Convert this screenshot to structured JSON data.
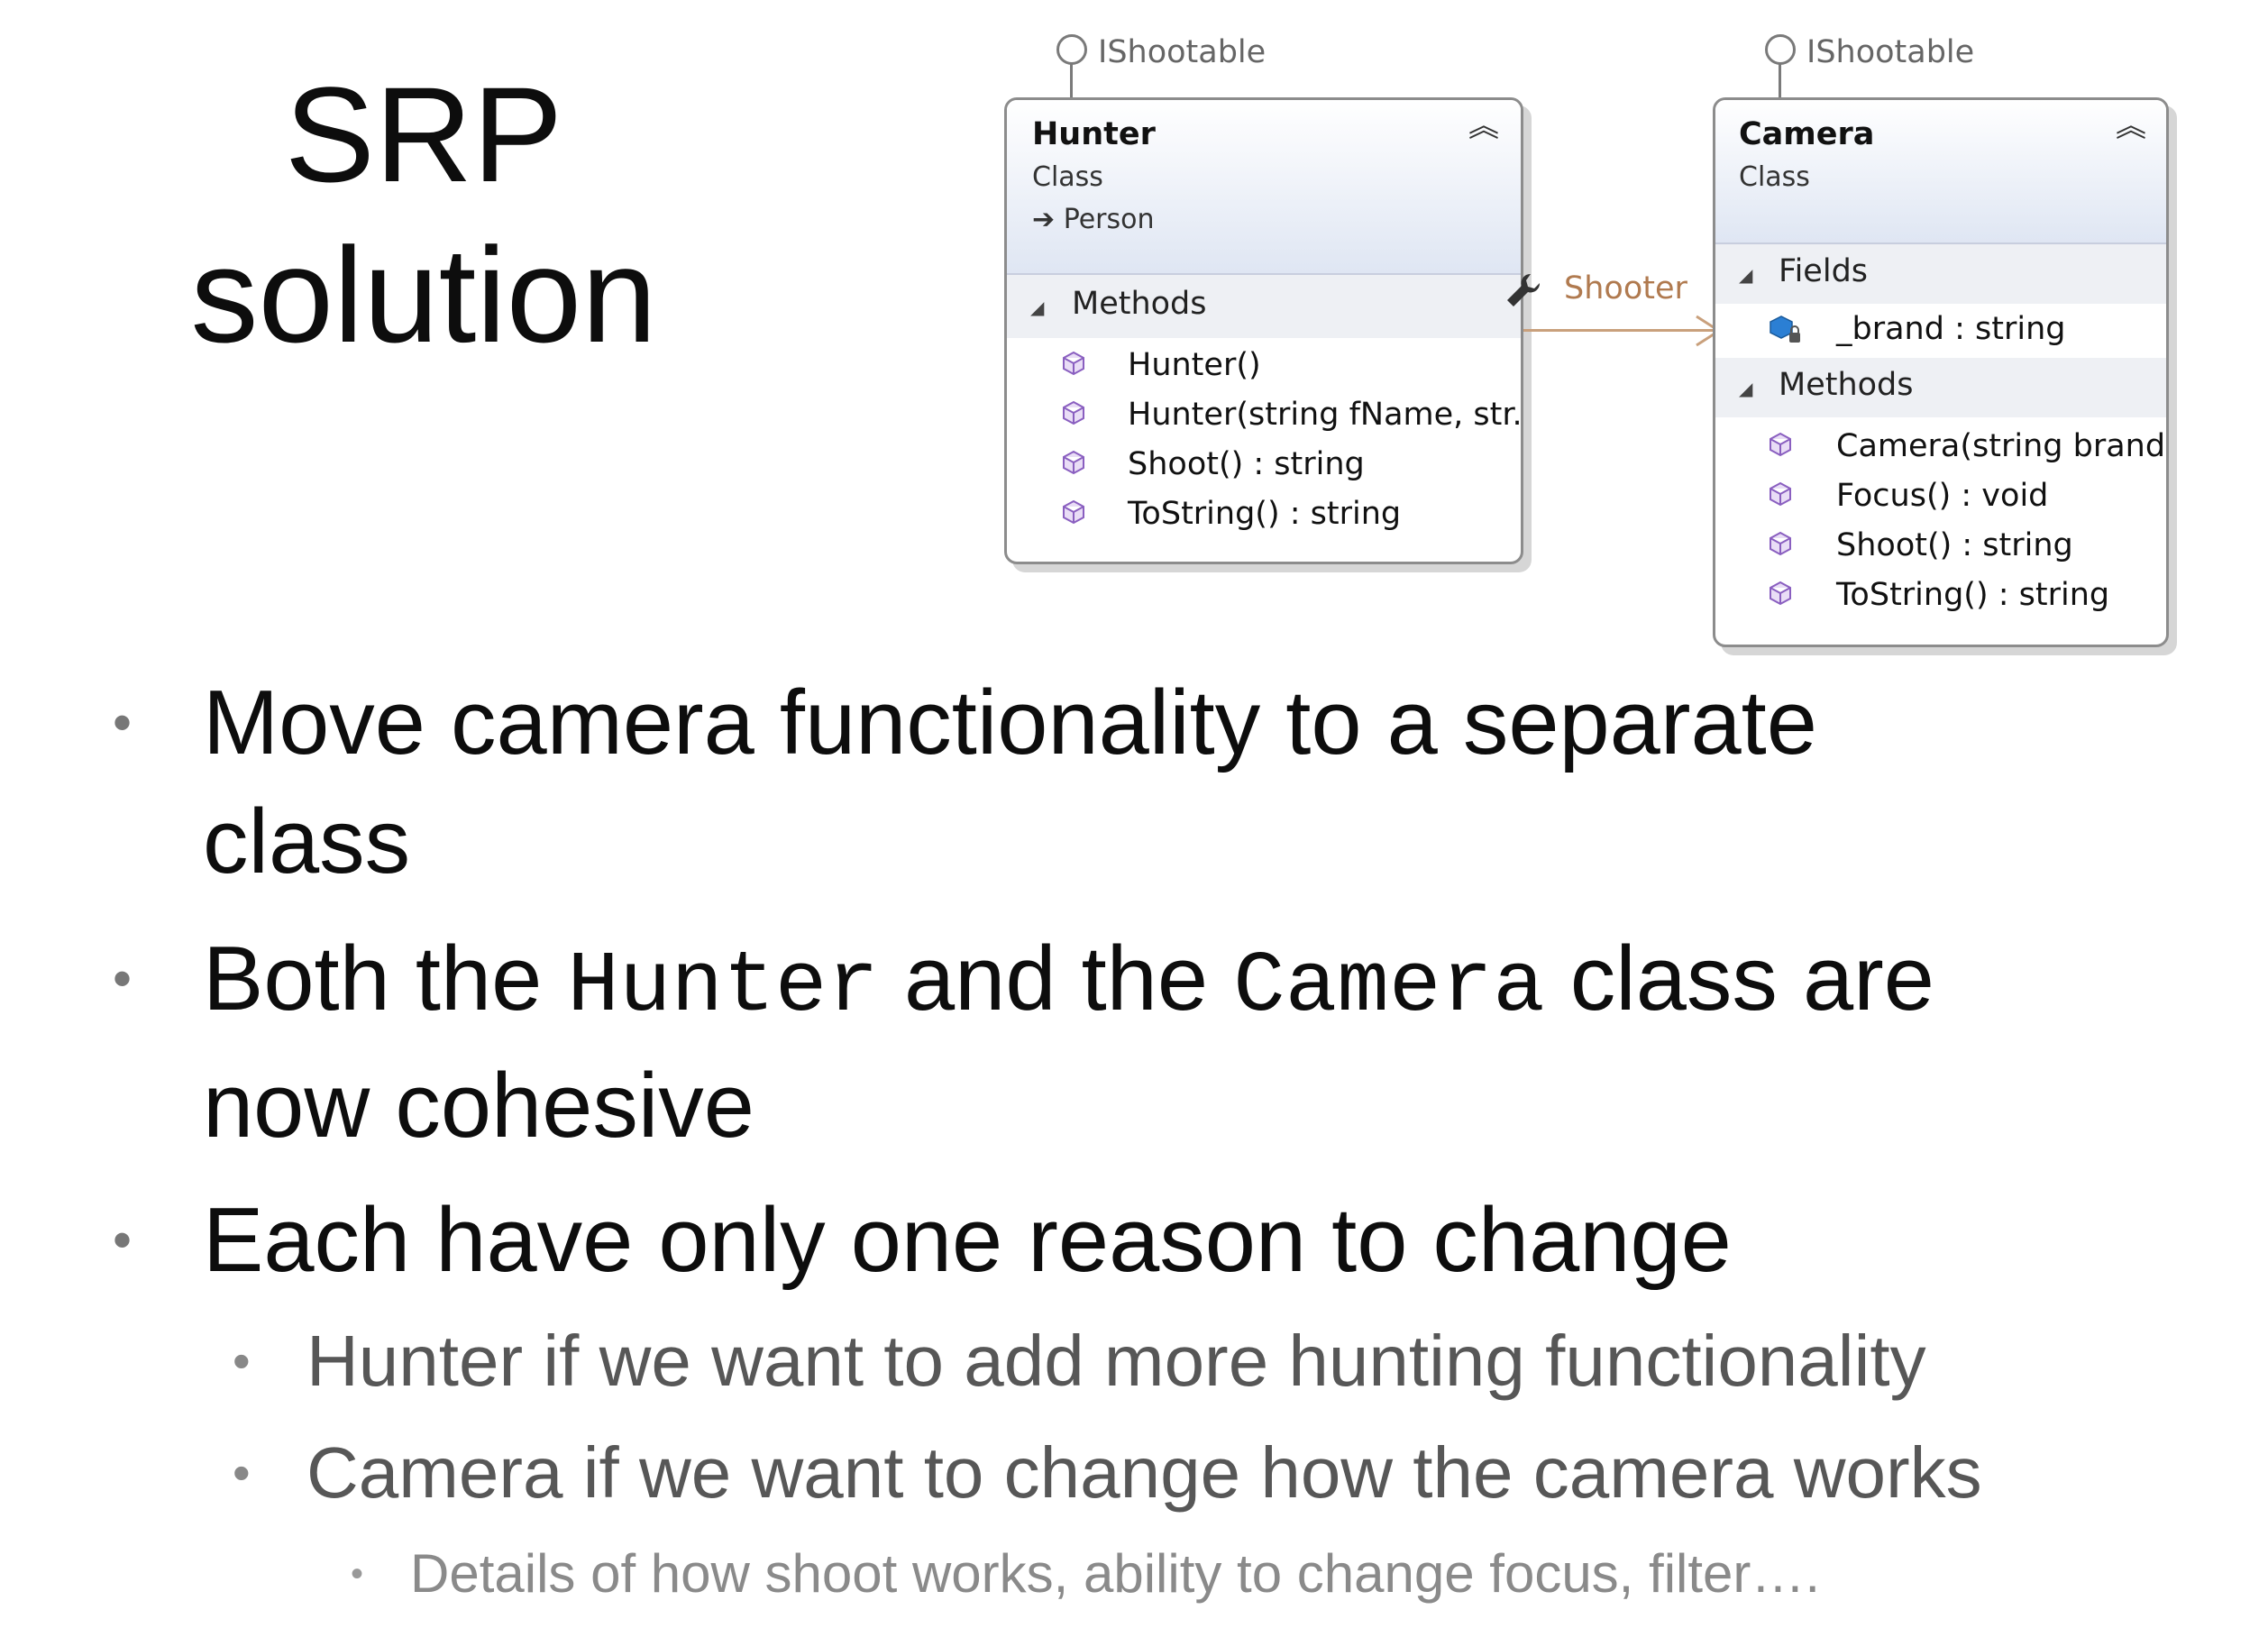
{
  "title": {
    "line1": "SRP",
    "line2": "solution"
  },
  "diagram": {
    "hunter": {
      "interface": "IShootable",
      "name": "Hunter",
      "kind": "Class",
      "base": "Person",
      "methods_label": "Methods",
      "methods": [
        "Hunter()",
        "Hunter(string fName, str...",
        "Shoot() : string",
        "ToString() : string"
      ]
    },
    "camera": {
      "interface": "IShootable",
      "name": "Camera",
      "kind": "Class",
      "fields_label": "Fields",
      "fields": [
        "_brand : string"
      ],
      "methods_label": "Methods",
      "methods": [
        "Camera(string brand)",
        "Focus() : void",
        "Shoot() : string",
        "ToString() : string"
      ]
    },
    "association_label": "Shooter"
  },
  "bullets": {
    "b1_line1": "Move camera functionality to a separate",
    "b1_line2": "class",
    "b2_pre": "Both the ",
    "b2_code1": "Hunter",
    "b2_mid": " and the ",
    "b2_code2": "Camera",
    "b2_post": " class are",
    "b2_line2": "now cohesive",
    "b3": "Each have only one reason to change",
    "sub1": "Hunter if we want to add more hunting functionality",
    "sub2": "Camera if we want to change how the camera works",
    "subsub1": "Details of how shoot works, ability to change focus, filter…."
  },
  "colors": {
    "header_gradient": "#dfe6f3",
    "association": "#c9a07c",
    "method_icon": "#8a5fc0"
  }
}
